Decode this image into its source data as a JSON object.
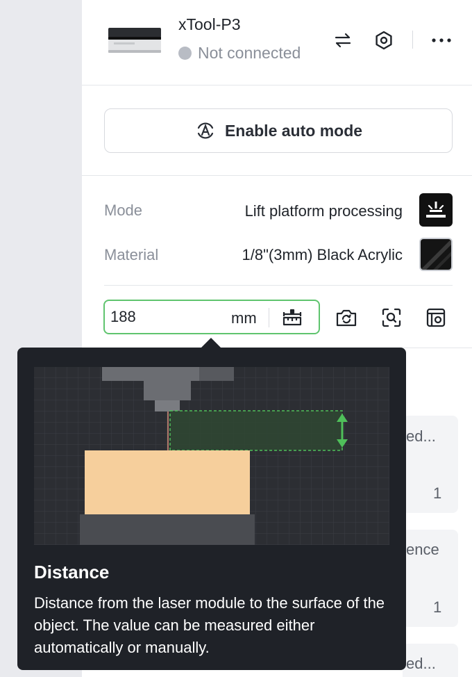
{
  "device": {
    "name": "xTool-P3",
    "status": "Not connected",
    "status_color": "#b8bcc4"
  },
  "header_icons": [
    "swap-icon",
    "settings-hex-icon",
    "more-icon"
  ],
  "auto_mode": {
    "label": "Enable auto mode"
  },
  "mode": {
    "label": "Mode",
    "value": "Lift platform processing"
  },
  "material": {
    "label": "Material",
    "value": "1/8\"(3mm) Black Acrylic"
  },
  "distance": {
    "value": "188",
    "unit": "mm",
    "border_color": "#5fc46e"
  },
  "tools": [
    "camera-refresh-icon",
    "scan-focus-icon",
    "framing-icon"
  ],
  "background_cards": [
    {
      "text": "ed...",
      "count": "1"
    },
    {
      "text": "ence",
      "count": "1"
    },
    {
      "text": "ed..."
    }
  ],
  "tooltip": {
    "title": "Distance",
    "description": "Distance from the laser module to the surface of the object. The value can be measured either automatically or manually."
  }
}
